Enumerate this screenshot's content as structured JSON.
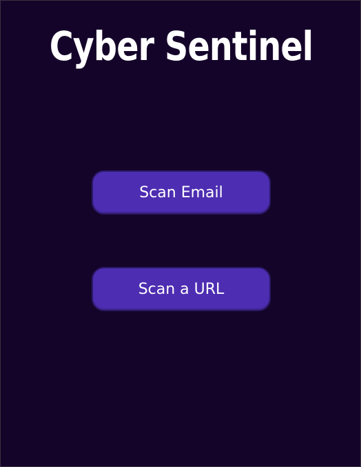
{
  "app": {
    "title": "Cyber Sentinel"
  },
  "actions": {
    "scan_email_label": "Scan Email",
    "scan_url_label": "Scan a URL"
  },
  "colors": {
    "background": "#15042a",
    "button": "#4d2db1",
    "text": "#ffffff"
  }
}
